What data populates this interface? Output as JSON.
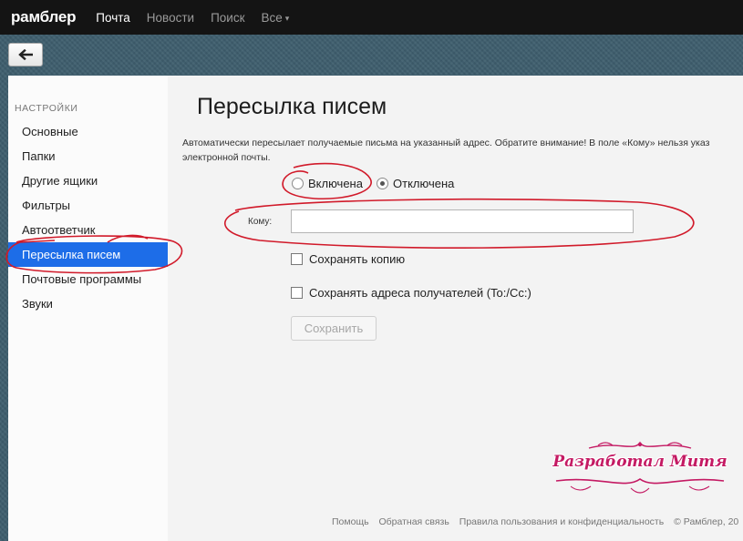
{
  "topbar": {
    "logo": "рамблер",
    "nav": [
      "Почта",
      "Новости",
      "Поиск",
      "Все"
    ],
    "nav_caret": "▾"
  },
  "back_button": {
    "icon": "arrow-left-icon"
  },
  "sidebar": {
    "heading": "НАСТРОЙКИ",
    "items": [
      {
        "label": "Основные"
      },
      {
        "label": "Папки"
      },
      {
        "label": "Другие ящики"
      },
      {
        "label": "Фильтры"
      },
      {
        "label": "Автоответчик"
      },
      {
        "label": "Пересылка писем",
        "active": true
      },
      {
        "label": "Почтовые программы"
      },
      {
        "label": "Звуки"
      }
    ]
  },
  "main": {
    "title": "Пересылка писем",
    "description_line1": "Автоматически пересылает получаемые письма на указанный адрес. Обратите внимание! В поле «Кому» нельзя указ",
    "description_line2": "электронной почты.",
    "radio_on": "Включена",
    "radio_off": "Отключена",
    "selected": "Отключена",
    "to_label": "Кому:",
    "to_value": "",
    "to_placeholder": "",
    "checkbox_copy": "Сохранять копию",
    "checkbox_addresses": "Сохранять адреса получателей (To:/Cc:)",
    "save_button": "Сохранить",
    "save_disabled": true
  },
  "footer": {
    "help": "Помощь",
    "feedback": "Обратная связь",
    "rules": "Правила пользования и конфиденциальность",
    "copyright": "© Рамблер, 20"
  },
  "watermark": {
    "text": "Разработал Митя"
  },
  "colors": {
    "accent": "#1d6de8",
    "annotation": "#d11a2a",
    "watermark": "#c41a63",
    "topbar": "#141414"
  }
}
